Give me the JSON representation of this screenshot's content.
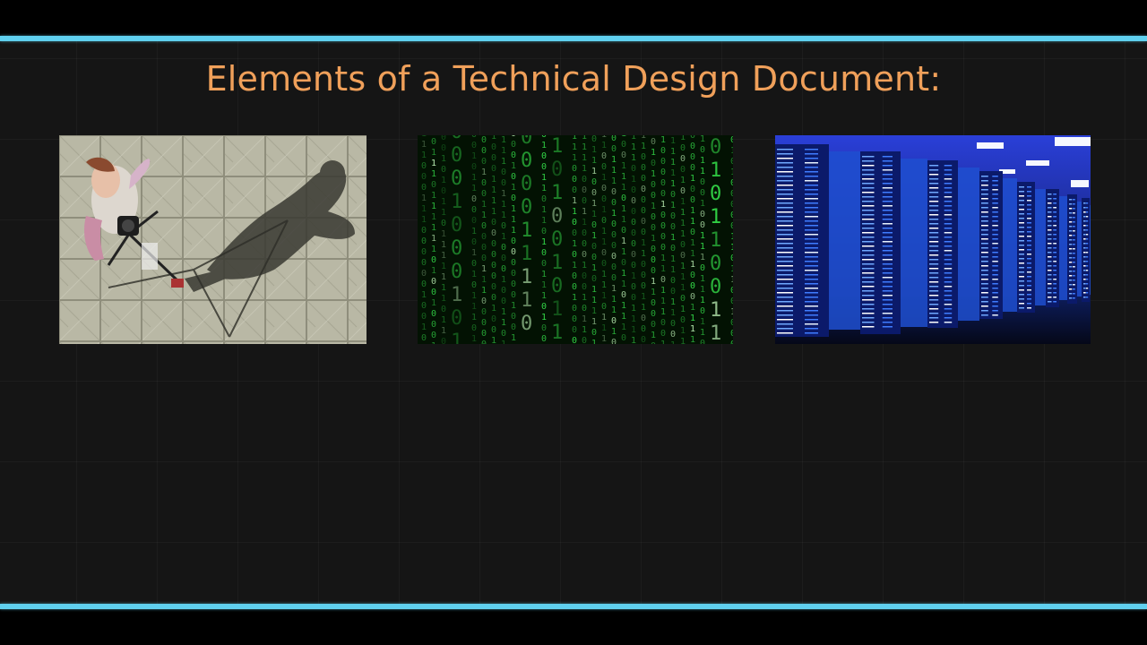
{
  "slide": {
    "title": "Elements of a Technical Design Document:",
    "accent_color": "#5fd0ef",
    "title_color": "#f0a05a",
    "background_color": "#151515"
  },
  "images": [
    {
      "id": "photographer",
      "depicts": "photographer-with-tripod-casting-shadow"
    },
    {
      "id": "binary-code",
      "depicts": "green-binary-code-rain"
    },
    {
      "id": "server-racks",
      "depicts": "blue-lit-server-room"
    }
  ]
}
